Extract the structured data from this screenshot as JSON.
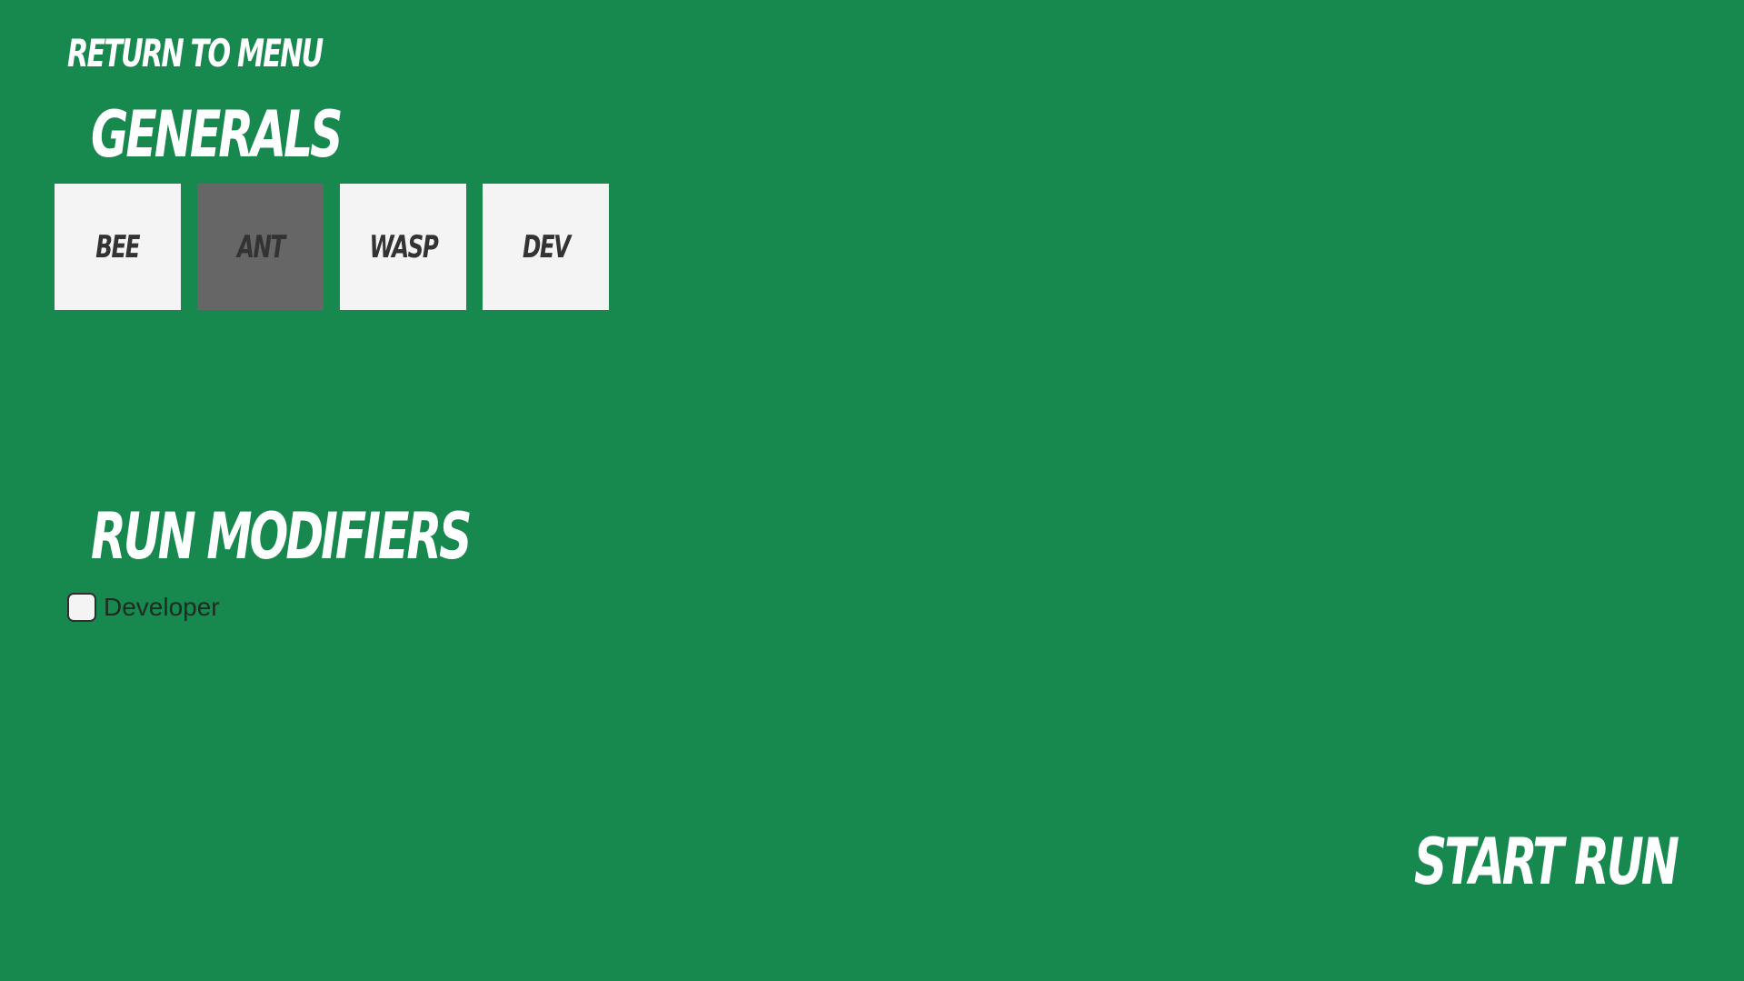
{
  "nav": {
    "return_label": "Return to Menu"
  },
  "generals": {
    "title": "Generals",
    "cards": [
      {
        "label": "Bee",
        "selected": false
      },
      {
        "label": "Ant",
        "selected": true
      },
      {
        "label": "Wasp",
        "selected": false
      },
      {
        "label": "Dev",
        "selected": false
      }
    ]
  },
  "modifiers": {
    "title": "Run Modifiers",
    "items": [
      {
        "label": "Developer",
        "checked": false
      }
    ]
  },
  "actions": {
    "start_label": "Start Run"
  },
  "colors": {
    "background": "#17894f",
    "card": "#f4f4f4",
    "card_selected": "#666666",
    "heading_text": "#ffffff",
    "card_text": "#333333"
  }
}
